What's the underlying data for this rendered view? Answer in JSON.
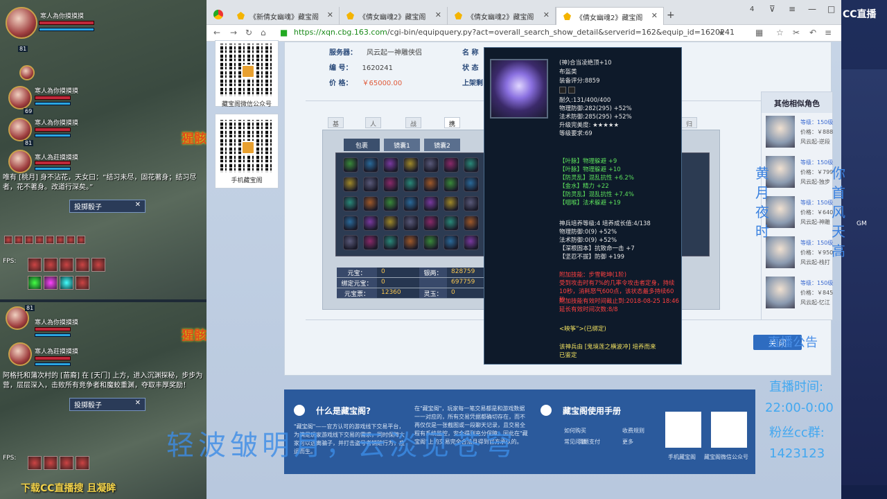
{
  "game": {
    "party": [
      "寒人為你摸摸摸",
      "寒人為你摸摸摸",
      "寒人為你摸摸摸",
      "寒人為莊摸摸摸"
    ],
    "levels": [
      "81",
      "69",
      "81",
      "81",
      "81"
    ],
    "chat1": "唯有 [桃月] 身不沾花，天女曰：“结习未尽，固花著身；结习尽者，花不著身。改道行深矣。”",
    "chat2": "阿格托和蒲次村的 [苗裔] 在 [天门] 上方，进入沉渊探秘，步步为营，层层深入，击败所有竞争者和魔蛟重渊，夺取丰厚奖励！",
    "btn_throw": "投掷骰子",
    "fps": "FPS:",
    "download": "下载CC直播搜 且凝眸"
  },
  "browser": {
    "tabs": [
      "《新倩女幽魂》藏宝阁",
      "《倩女幽魂2》藏宝阁",
      "《倩女幽魂2》藏宝阁",
      "《倩女幽魂2》藏宝阁"
    ],
    "url_scheme": "https://",
    "url_host": "xqn.cbg.163.com",
    "url_path": "/cgi-bin/equipquery.py?act=overall_search_show_detail&serverid=162&equip_id=1620241"
  },
  "qr": {
    "wechat": "藏宝阁微信公众号",
    "mobile": "手机藏宝阁"
  },
  "info": {
    "server_label": "服务器：",
    "server_value": "风云起一神雕侠侣",
    "id_label": "编  号：",
    "id_value": "1620241",
    "price_label": "价  格：",
    "price_value": "￥65000.00",
    "name_label": "名  称",
    "status_label": "状  态",
    "listed_label": "上架剩"
  },
  "ptabs": [
    "基础属性",
    "人物抗性",
    "战斗属性",
    "携带物品",
    "归梦案"
  ],
  "bagtabs": [
    "包裹",
    "镜囊1",
    "镜囊2"
  ],
  "money": {
    "yuanbao_l": "元宝：",
    "yuanbao_v": "0",
    "yinliang_l": "银两：",
    "yinliang_v": "828759",
    "bind_l": "绑定元宝：",
    "bind_v": "0",
    "bind2_v": "697759",
    "ticket_l": "元宝票：",
    "ticket_v": "12360",
    "lingyu_l": "灵玉：",
    "lingyu_v": "0"
  },
  "close_btn": "关  闭",
  "tooltip": {
    "name": "(神)合当凌绝顶+10",
    "type": "布盔类",
    "score": "装备评分:8859",
    "dur": "耐久:131/400/400",
    "pdef": "物理防御:282(295) +52%",
    "mdef": "法术防御:285(295) +52%",
    "perfect": "升级完美度: ★★★★★",
    "lvreq": "等级要求:69",
    "gems": [
      "【叶脉】物理躲避 +9",
      "【叶脉】物理躲避 +10",
      "【防灵乱】混乱抗性 +6.2%",
      "【金水】精力 +22",
      "【防灵乱】混乱抗性 +7.4%",
      "【咽喉】法术躲避 +19"
    ],
    "forge": "神兵培养等级:4 培养成长值:4/138",
    "forge_p": "物理防御:0(9) +52%",
    "forge_m": "法术防御:0(9) +52%",
    "skill1": "【深根固本】抗致命一击 +7",
    "skill2": "【坚忍不拔】防御 +199",
    "extra_title": "附加技能：步雪乾坤(1阶)",
    "extra_desc": "受到攻击时有7%的几率令攻击者定身，持续10秒，消耗怒气600点，该状态最多持续60秒",
    "extra_time": "附加技能有效时间截止到:2018-08-25 18:46",
    "extra_rem": "延长有效时间次数:8/8",
    "bind": "<映筝”>(已绑定)",
    "made_by": "该神兵由 [鬼境莲之横波冲] 培养而来",
    "identified": "已鉴定"
  },
  "footer": {
    "what_title": "什么是藏宝阁?",
    "what_text": "\"藏宝阁\"——官方认可的游戏线下交易平台，为满足玩家游戏线下交易的需求，同时保障大家可以远离骗子，并打击盗号者销赃行为，应运而生。",
    "mid_text": "在\"藏宝阁\"，玩家每一笔交易都是和游戏数据一一对应的，所有交易凭据都确切存在，而不再仅仅是一张截图或一段聊天记录，且交易全程有系统监控，安全得到充分保障。因此在\"藏宝阁\"上的交易完全合法且得到官方承认的。",
    "manual_title": "藏宝阁使用手册",
    "links": [
      "如何购买",
      "常见问题",
      "问题支付",
      "收费规则",
      "更多"
    ],
    "qr1": "手机藏宝阁",
    "qr2": "藏宝阁微信公众号"
  },
  "similar": {
    "title": "其他相似角色",
    "rows": [
      {
        "lv": "等级：150级",
        "price": "价格：￥888",
        "srv": "风云起-逆段"
      },
      {
        "lv": "等级：150级",
        "price": "价格：￥799",
        "srv": "风云起-独步"
      },
      {
        "lv": "等级：150级",
        "price": "价格：￥640",
        "srv": "风云起-神雕"
      },
      {
        "lv": "等级：150级",
        "price": "价格：￥950",
        "srv": "风云起-栈打"
      },
      {
        "lv": "等级：150级",
        "price": "价格：￥845",
        "srv": "风云起-忆江"
      }
    ]
  },
  "stream": {
    "cc_logo": "CC直播",
    "notice": "直播公告",
    "time_label": "直播时间:",
    "time_value": "22:00-0:00",
    "fans_label": "粉丝cc群:",
    "fans_value": "1423123",
    "vertical_left": "黄月夜时",
    "vertical_right": "你首风天高",
    "big_overlay": "轻波皱明月，云淡见苍穹",
    "gm": "GM"
  }
}
